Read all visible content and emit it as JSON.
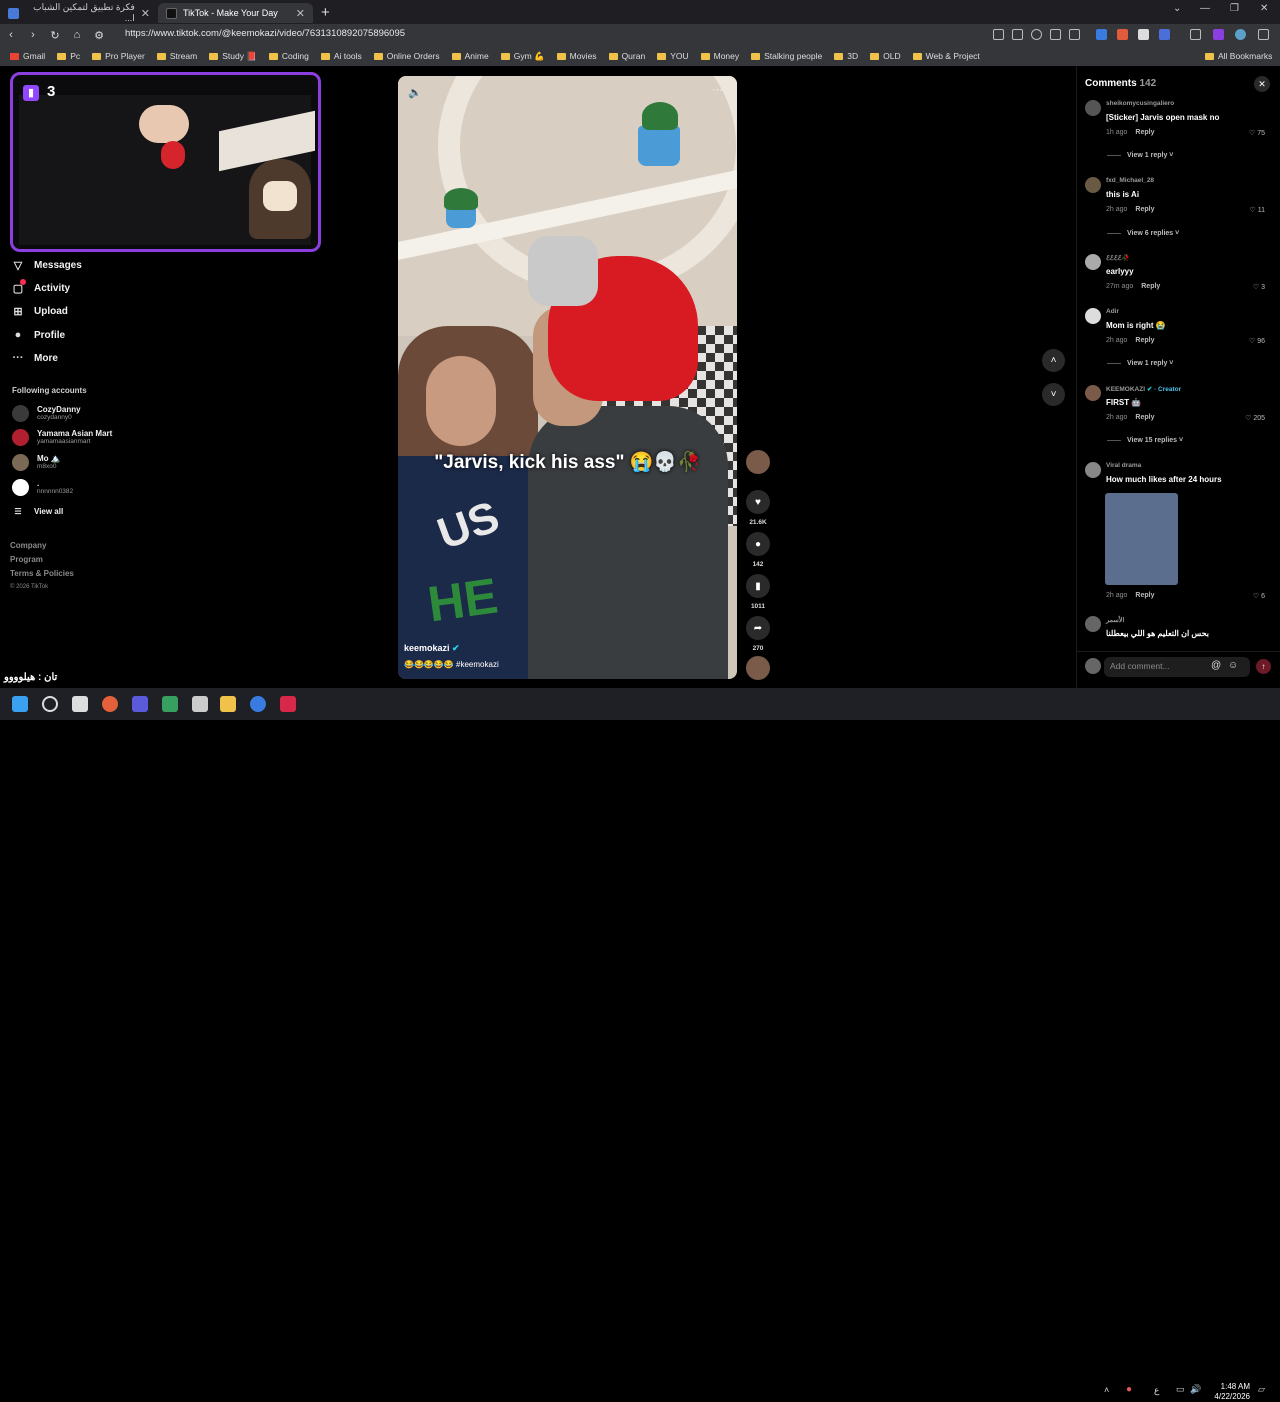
{
  "browser": {
    "tabs": [
      {
        "title": "فكرة تطبيق لتمكين الشباب ا...",
        "active": false
      },
      {
        "title": "TikTok - Make Your Day",
        "active": true
      }
    ],
    "new_tab": "+",
    "url": "https://www.tiktok.com/@keemokazi/video/7631310892075896095",
    "bookmarks": [
      "Gmail",
      "Pc",
      "Pro Player",
      "Stream",
      "Study 📕",
      "Coding",
      "Ai tools",
      "Online Orders",
      "Anime",
      "Gym 💪",
      "Movies",
      "Quran",
      "YOU",
      "Money",
      "Stalking people",
      "3D",
      "OLD",
      "Web & Project"
    ],
    "all_bookmarks": "All Bookmarks"
  },
  "stream": {
    "viewer_count": "3"
  },
  "nav": [
    {
      "label": "Messages",
      "icon": "send-icon"
    },
    {
      "label": "Activity",
      "icon": "inbox-icon"
    },
    {
      "label": "Upload",
      "icon": "plus-square-icon"
    },
    {
      "label": "Profile",
      "icon": "avatar-icon"
    },
    {
      "label": "More",
      "icon": "more-icon"
    }
  ],
  "following": {
    "title": "Following accounts",
    "accounts": [
      {
        "name": "CozyDanny",
        "handle": "cozydanny0"
      },
      {
        "name": "Yamama Asian Mart",
        "handle": "yamamaasianmart"
      },
      {
        "name": "Mo 🏔️",
        "handle": "m8xo0"
      },
      {
        "name": ".",
        "handle": "nnnnnn0382"
      }
    ],
    "view_all": "View all"
  },
  "footer": {
    "links": [
      "Company",
      "Program",
      "Terms & Policies"
    ],
    "copyright": "© 2026 TikTok"
  },
  "overlay_chat": "تان : هيلوووو",
  "video": {
    "caption": "\"Jarvis, kick his ass\" 😭💀🥀",
    "author": "keemokazi",
    "description": "😂😂😂😂😂 #keemokazi",
    "counts": {
      "likes": "21.6K",
      "comments": "142",
      "saves": "1011",
      "shares": "270"
    }
  },
  "comments": {
    "title": "Comments",
    "count": "142",
    "items": [
      {
        "user": "sheikomycusingaliero",
        "text": "[Sticker] Jarvis open mask no",
        "time": "1h ago",
        "reply": "Reply",
        "likes": "75",
        "replies": "View 1 reply"
      },
      {
        "user": "fxd_Michael_28",
        "text": "this is Ai",
        "time": "2h ago",
        "reply": "Reply",
        "likes": "11",
        "replies": "View 6 replies"
      },
      {
        "user": "ℰℰℰℰ🥀",
        "text": "earlyyy",
        "time": "27m ago",
        "reply": "Reply",
        "likes": "3",
        "replies": ""
      },
      {
        "user": "Adir",
        "text": "Mom is right 😭",
        "time": "2h ago",
        "reply": "Reply",
        "likes": "96",
        "replies": "View 1 reply"
      },
      {
        "user": "KEEMOKAZI",
        "badge": "· Creator",
        "text": "FIRST 🤖",
        "time": "2h ago",
        "reply": "Reply",
        "likes": "205",
        "replies": "View 15 replies"
      },
      {
        "user": "Viral drama",
        "text": "How much likes after 24 hours",
        "time": "2h ago",
        "reply": "Reply",
        "likes": "6",
        "replies": ""
      },
      {
        "user": "الأسمر",
        "text": "بحس ان التعليم هو اللي بيعطلنا",
        "time": "",
        "reply": "",
        "likes": "",
        "replies": ""
      }
    ],
    "add_placeholder": "Add comment..."
  },
  "taskbar": {
    "time": "1:48 AM",
    "date": "4/22/2026",
    "lang": "ع"
  }
}
